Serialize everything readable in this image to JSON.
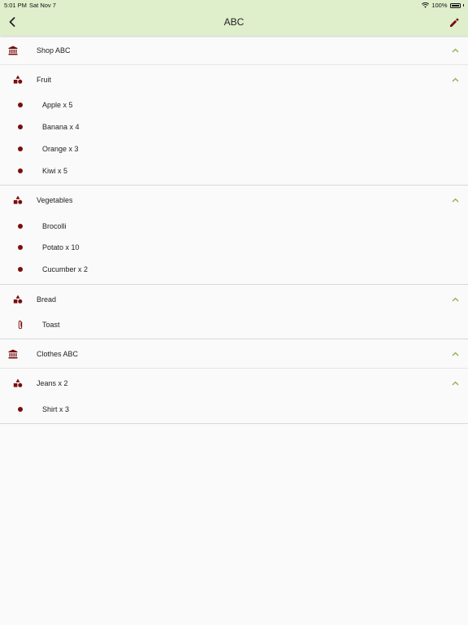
{
  "status": {
    "time": "5:01 PM",
    "date": "Sat Nov 7",
    "battery": "100%"
  },
  "header": {
    "title": "ABC"
  },
  "colors": {
    "accent": "#7a0e0e",
    "header_bg": "#dfeecb",
    "chevron": "#8bae4a"
  },
  "shops": [
    {
      "name": "Shop ABC",
      "categories": [
        {
          "name": "Fruit",
          "items": [
            "Apple x 5",
            "Banana x 4",
            "Orange x 3",
            "Kiwi x 5"
          ]
        },
        {
          "name": "Vegetables",
          "items": [
            "Brocolli",
            "Potato x 10",
            "Cucumber x 2"
          ]
        },
        {
          "name": "Bread",
          "items": [
            "Toast"
          ]
        }
      ]
    },
    {
      "name": "Clothes ABC",
      "categories": [
        {
          "name": "Jeans x 2",
          "items": [
            "Shirt x 3"
          ]
        }
      ]
    }
  ]
}
